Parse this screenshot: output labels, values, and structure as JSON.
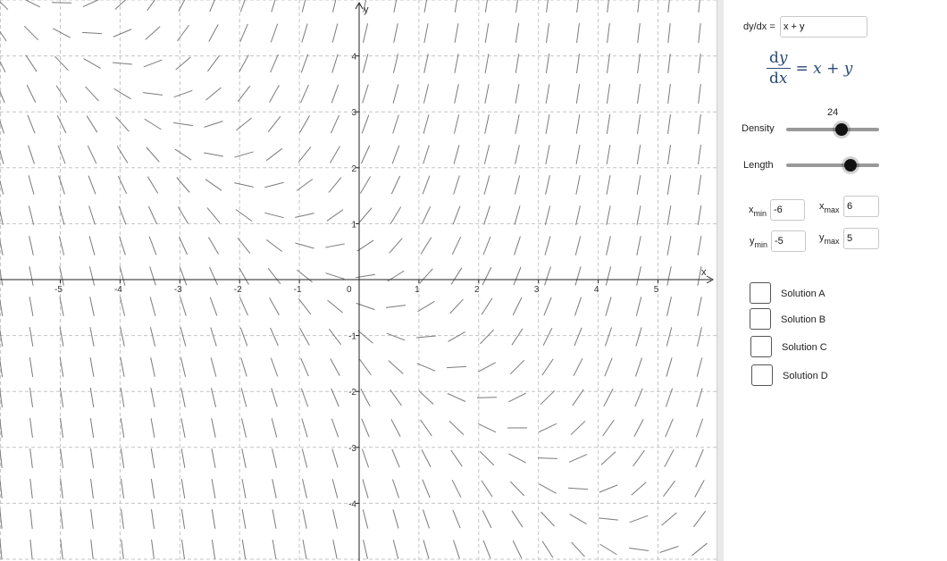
{
  "graph": {
    "x_axis_label": "x",
    "y_axis_label": "y",
    "origin_label": "0",
    "x_ticks": [
      -5,
      -4,
      -3,
      -2,
      -1,
      1,
      2,
      3,
      4,
      5
    ],
    "y_ticks": [
      4,
      3,
      2,
      1,
      -1,
      -2,
      -3,
      -4
    ],
    "view": {
      "xmin": -6,
      "xmax": 6,
      "ymin": -5,
      "ymax": 5
    },
    "field_formula": "x + y",
    "density": 24
  },
  "panel": {
    "equation_label": "dy/dx =",
    "equation_value": "x + y",
    "formula": {
      "num_d": "d",
      "num_var": "y",
      "den_d": "d",
      "den_var": "x",
      "rhs": "= x + y"
    },
    "density": {
      "label": "Density",
      "value": "24",
      "fraction": 0.6
    },
    "length": {
      "label": "Length",
      "fraction": 0.69
    },
    "xmin": {
      "var": "x",
      "sub": "min",
      "value": "-6"
    },
    "xmax": {
      "var": "x",
      "sub": "max",
      "value": "6"
    },
    "ymin": {
      "var": "y",
      "sub": "min",
      "value": "-5"
    },
    "ymax": {
      "var": "y",
      "sub": "max",
      "value": "5"
    },
    "solutions": [
      "Solution A",
      "Solution B",
      "Solution C",
      "Solution D"
    ]
  }
}
